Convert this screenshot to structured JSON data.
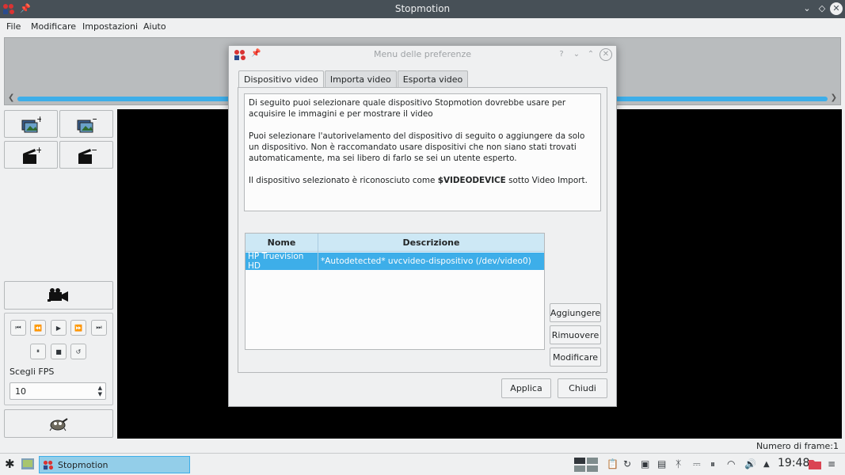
{
  "window": {
    "title": "Stopmotion",
    "menu": [
      "File",
      "Modificare",
      "Impostazioni",
      "Aiuto"
    ]
  },
  "player": {
    "fps_label": "Scegli FPS",
    "fps_value": "10"
  },
  "statusbar": {
    "frame_count": "Numero di frame:1"
  },
  "taskbar": {
    "task_label": "Stopmotion",
    "clock": "19:48"
  },
  "dialog": {
    "title": "Menu delle preferenze",
    "tabs": [
      "Dispositivo video",
      "Importa video",
      "Esporta video"
    ],
    "info": {
      "p1": "Di seguito puoi selezionare quale dispositivo Stopmotion dovrebbe usare per acquisire le immagini e per mostrare il video",
      "p2": "Puoi selezionare l'autorivelamento del dispositivo di seguito o aggiungere da solo un dispositivo. Non è raccomandato usare dispositivi che non siano stati trovati automaticamente, ma sei libero di farlo se sei un utente esperto.",
      "p3_prefix": "Il dispositivo selezionato è riconosciuto come ",
      "p3_bold": "$VIDEODEVICE",
      "p3_suffix": " sotto Video Import."
    },
    "table": {
      "headers": [
        "Nome",
        "Descrizione"
      ],
      "rows": [
        {
          "name": "HP Truevision HD",
          "description": "*Autodetected* uvcvideo-dispositivo (/dev/video0)"
        }
      ]
    },
    "buttons": {
      "add": "Aggiungere",
      "remove": "Rimuovere",
      "edit": "Modificare",
      "apply": "Applica",
      "close": "Chiudi"
    }
  }
}
